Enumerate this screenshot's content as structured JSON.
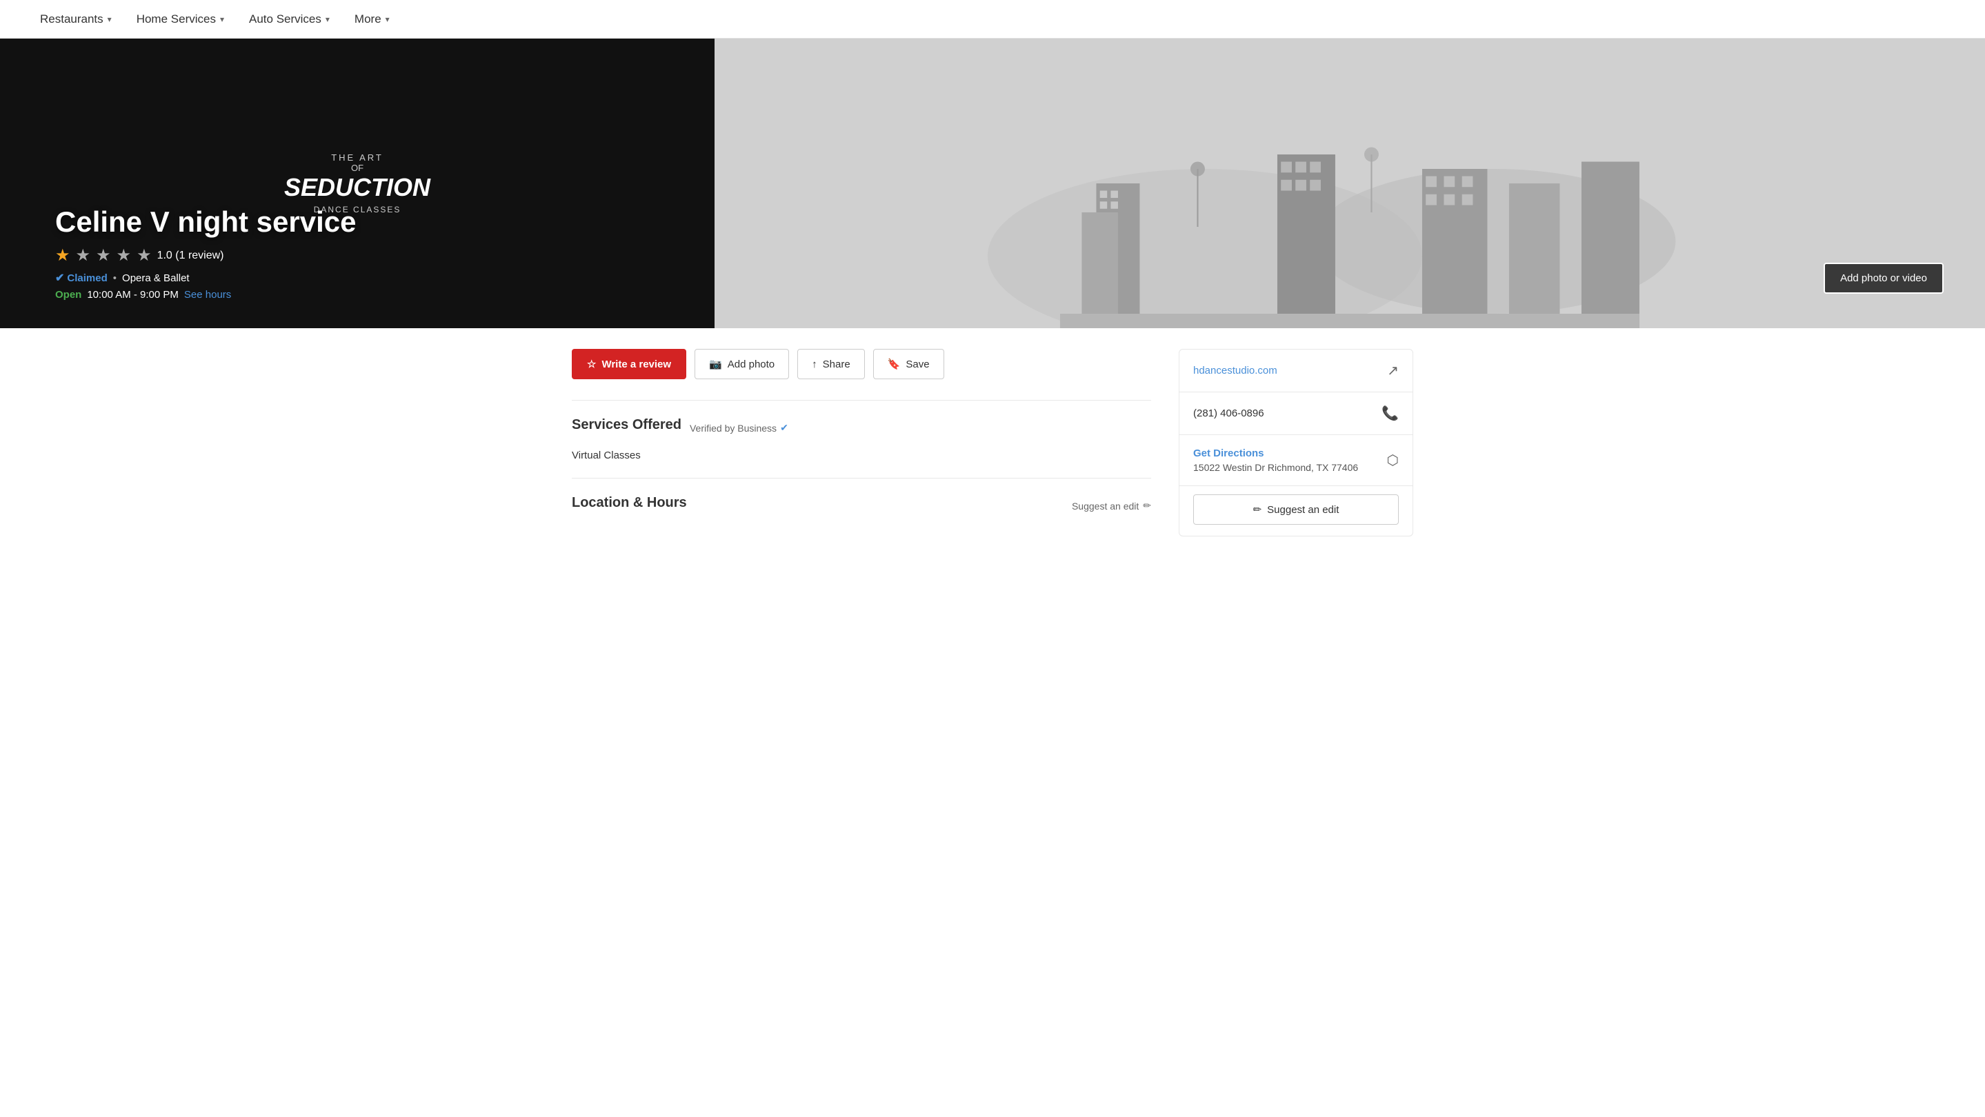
{
  "nav": {
    "items": [
      {
        "label": "Restaurants",
        "id": "restaurants"
      },
      {
        "label": "Home Services",
        "id": "home-services"
      },
      {
        "label": "Auto Services",
        "id": "auto-services"
      },
      {
        "label": "More",
        "id": "more"
      }
    ]
  },
  "hero": {
    "business_name": "Celine V night service",
    "rating_value": "1.0",
    "review_count": "1 review",
    "rating_display": "1.0 (1 review)",
    "claimed_label": "Claimed",
    "category": "Opera & Ballet",
    "status": "Open",
    "hours": "10:00 AM - 9:00 PM",
    "see_hours_label": "See hours",
    "add_photo_label": "Add photo or video",
    "art_title1": "THE ART",
    "art_title2": "OF",
    "art_title3": "SEDUCTION",
    "art_title4": "DANCE CLASSES"
  },
  "actions": {
    "write_review": "Write a review",
    "add_photo": "Add photo",
    "share": "Share",
    "save": "Save"
  },
  "services": {
    "section_title": "Services Offered",
    "verified_label": "Verified by Business",
    "items": [
      {
        "name": "Virtual Classes"
      }
    ]
  },
  "location_hours": {
    "section_title": "Location & Hours",
    "suggest_edit_label": "Suggest an edit"
  },
  "sidebar": {
    "website": "hdancestudio.com",
    "phone": "(281) 406-0896",
    "directions_label": "Get Directions",
    "address": "15022 Westin Dr Richmond, TX 77406",
    "suggest_edit_label": "Suggest an edit"
  },
  "stars": [
    {
      "filled": true
    },
    {
      "filled": false
    },
    {
      "filled": false
    },
    {
      "filled": false
    },
    {
      "filled": false
    }
  ]
}
